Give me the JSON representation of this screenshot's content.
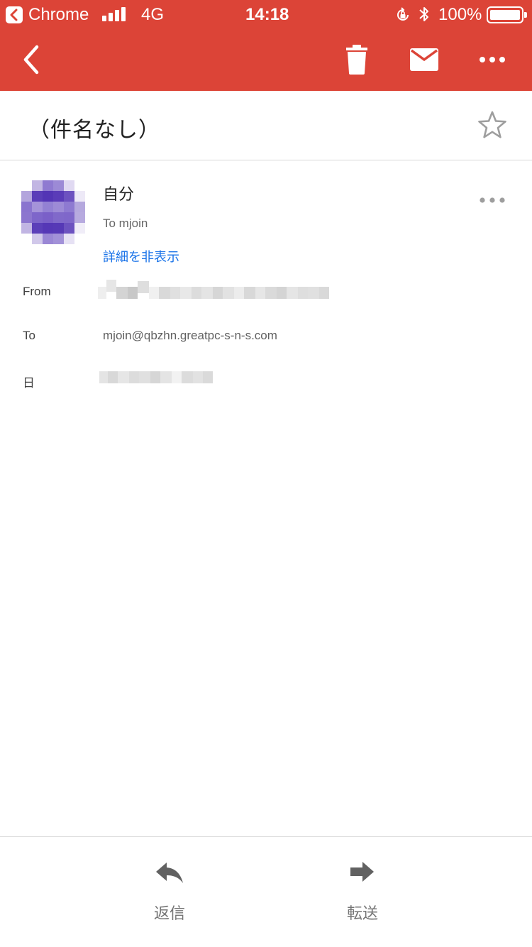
{
  "status_bar": {
    "back_app": "Chrome",
    "signal_bars": 4,
    "network": "4G",
    "time": "14:18",
    "battery_percent": "100%",
    "battery_level": 1.0
  },
  "app_bar": {
    "color": "#dc4437",
    "icons": [
      "back-icon",
      "trash-icon",
      "mail-icon",
      "more-icon"
    ]
  },
  "email": {
    "subject": "（件名なし）",
    "starred": false,
    "sender_name": "自分",
    "to_summary": "To mjoin",
    "hide_details_label": "詳細を非表示",
    "details": {
      "from_label": "From",
      "to_label": "To",
      "to_value": "mjoin@qbzhn.greatpc-s-n-s.com",
      "date_label": "日"
    }
  },
  "bottom_actions": {
    "reply_label": "返信",
    "forward_label": "転送"
  },
  "colors": {
    "accent": "#dc4437",
    "link": "#1a73e8"
  }
}
